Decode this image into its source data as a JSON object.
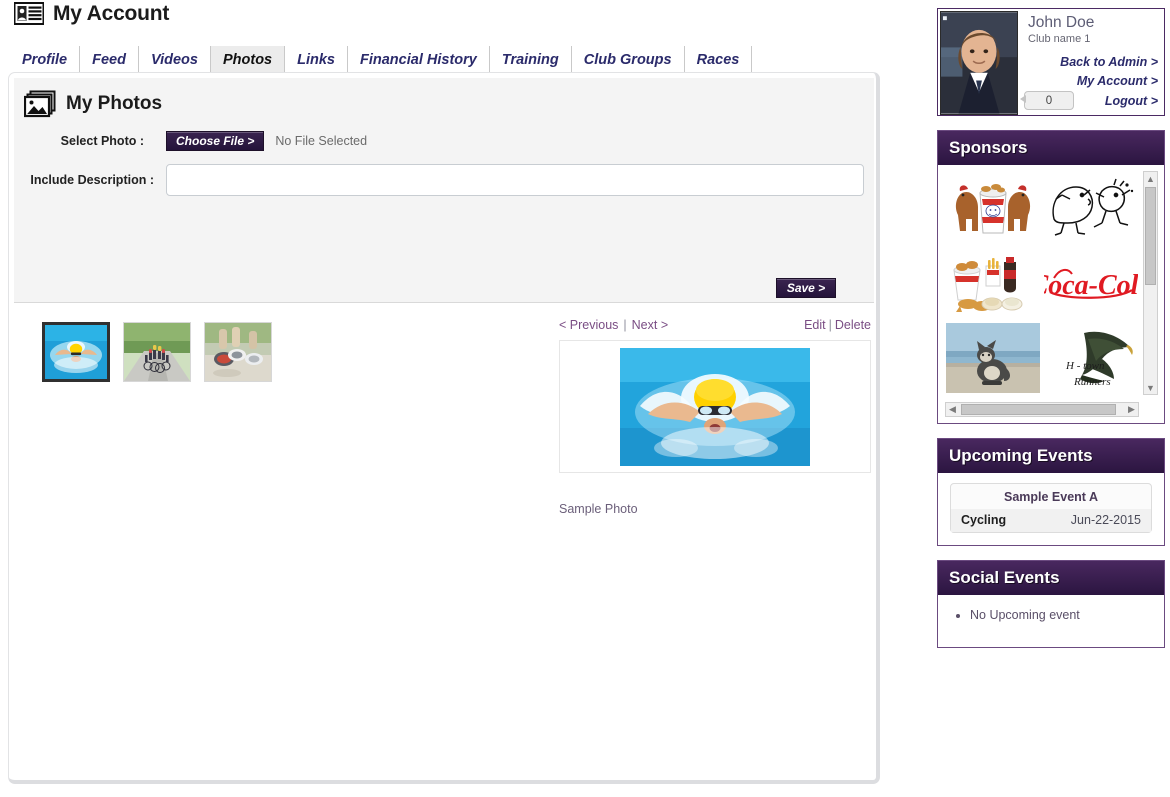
{
  "header": {
    "title": "My Account",
    "icon": "id-card-icon"
  },
  "tabs": [
    {
      "label": "Profile",
      "active": false
    },
    {
      "label": "Feed",
      "active": false
    },
    {
      "label": "Videos",
      "active": false
    },
    {
      "label": "Photos",
      "active": true
    },
    {
      "label": "Links",
      "active": false
    },
    {
      "label": "Financial History",
      "active": false
    },
    {
      "label": "Training",
      "active": false
    },
    {
      "label": "Club Groups",
      "active": false
    },
    {
      "label": "Races",
      "active": false
    }
  ],
  "photos_section": {
    "title": "My Photos",
    "icon": "photos-stack-icon",
    "select_photo_label": "Select Photo :",
    "choose_file_label": "Choose File >",
    "no_file_text": "No File Selected",
    "description_label": "Include Description :",
    "description_value": "",
    "description_placeholder": "",
    "save_label": "Save >"
  },
  "gallery": {
    "thumbnails": [
      {
        "name": "swimmer-thumbnail",
        "selected": true
      },
      {
        "name": "cyclists-thumbnail",
        "selected": false
      },
      {
        "name": "runners-thumbnail",
        "selected": false
      }
    ],
    "previous_label": "< Previous",
    "separator": "|",
    "next_label": "Next >",
    "edit_label": "Edit",
    "edit_separator": "|",
    "delete_label": "Delete",
    "caption": "Sample Photo"
  },
  "sidebar": {
    "profile": {
      "name": "John Doe",
      "club": "Club name 1",
      "message_count": "0",
      "links": [
        {
          "label": "Back to Admin >"
        },
        {
          "label": "My Account >"
        },
        {
          "label": "Logout >"
        }
      ]
    },
    "sponsors": {
      "title": "Sponsors",
      "logos": [
        {
          "name": "kfc-chickens-logo"
        },
        {
          "name": "cartoon-runners-logo"
        },
        {
          "name": "kfc-bucket-meal-logo"
        },
        {
          "name": "coca-cola-logo"
        },
        {
          "name": "cat-photo-logo"
        },
        {
          "name": "h-town-runners-logo"
        }
      ],
      "h_town_line1": "H - town",
      "h_town_line2": "Runners"
    },
    "upcoming_events": {
      "title": "Upcoming Events",
      "events": [
        {
          "name": "Sample Event A",
          "sport": "Cycling",
          "date": "Jun-22-2015"
        }
      ]
    },
    "social_events": {
      "title": "Social Events",
      "items": [
        "No Upcoming event"
      ]
    }
  },
  "colors": {
    "panel_header_dark": "#2b1540",
    "panel_header_light": "#49285f",
    "tab_text": "#2b2b6b",
    "link_purple": "#7a4d84",
    "button_purple": "#2d1b40"
  }
}
